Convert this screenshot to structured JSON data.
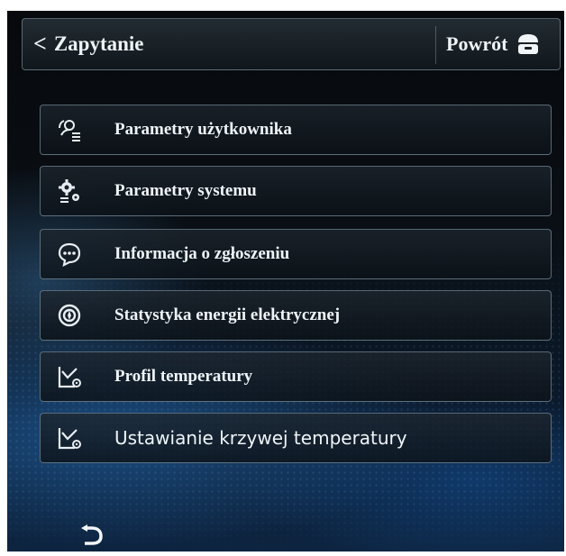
{
  "header": {
    "back_chevron": "<",
    "title": "Zapytanie",
    "home_label": "Powrót"
  },
  "menu": {
    "items": [
      {
        "label": "Parametry użytkownika",
        "icon": "user-settings-icon"
      },
      {
        "label": "Parametry systemu",
        "icon": "system-gears-icon"
      },
      {
        "label": "Informacja o zgłoszeniu",
        "icon": "message-bubble-icon"
      },
      {
        "label": "Statystyka energii elektrycznej",
        "icon": "energy-meter-icon"
      },
      {
        "label": "Profil temperatury",
        "icon": "temperature-curve-icon"
      },
      {
        "label": "Ustawianie krzywej temperatury",
        "icon": "temperature-curve-settings-icon"
      }
    ]
  },
  "footer": {
    "return_icon": "return-arrow-icon"
  },
  "colors": {
    "text": "#eef4f7",
    "border": "#96afbe",
    "background_dark": "#07090c",
    "glow_blue": "#2878c8"
  }
}
